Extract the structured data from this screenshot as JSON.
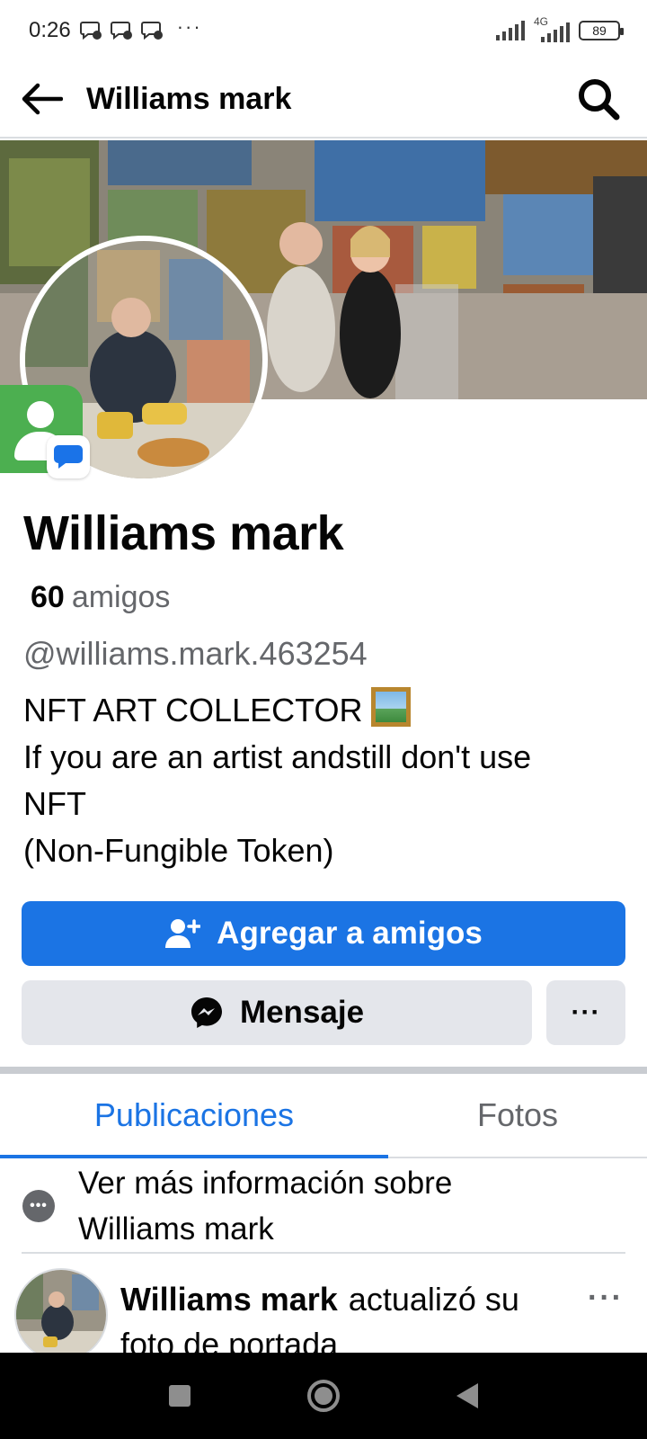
{
  "status_bar": {
    "time": "0:26",
    "network": "4G",
    "battery": "89",
    "more": "···"
  },
  "header": {
    "title": "Williams mark"
  },
  "profile": {
    "name": "Williams mark",
    "friends_count": "60",
    "friends_label": "amigos",
    "username": "@williams.mark.463254",
    "bio_lines": [
      "NFT ART COLLECTOR",
      "If you are an artist andstill don't use",
      "NFT",
      "(Non-Fungible Token)"
    ]
  },
  "actions": {
    "add_friend": "Agregar a amigos",
    "message": "Mensaje",
    "more": "···"
  },
  "tabs": [
    {
      "label": "Publicaciones",
      "active": true
    },
    {
      "label": "Fotos",
      "active": false
    }
  ],
  "info": {
    "line1": "Ver más información sobre",
    "line2": "Williams mark"
  },
  "post": {
    "author": "Williams mark",
    "action": "actualizó su foto de portada",
    "more": "···"
  },
  "colors": {
    "accent": "#1b74e4",
    "secondary_button": "#e4e6eb",
    "muted_text": "#65676b"
  }
}
